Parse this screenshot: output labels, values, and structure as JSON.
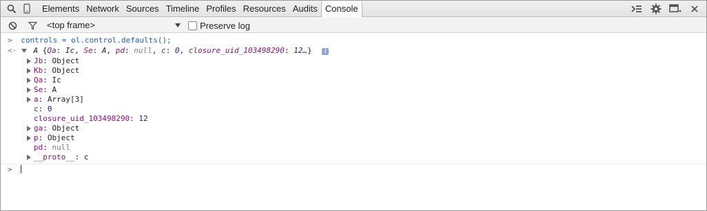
{
  "toolbar": {
    "tabs": [
      "Elements",
      "Network",
      "Sources",
      "Timeline",
      "Profiles",
      "Resources",
      "Audits",
      "Console"
    ],
    "active_tab": "Console"
  },
  "subbar": {
    "frame": "<top frame>",
    "preserve_log": "Preserve log"
  },
  "console": {
    "command": "controls = ol.control.defaults();",
    "summary": {
      "class": "A",
      "text": "{Qa: Ic, Se: A, pd: null, c: 0, closure_uid_103498290: 12…}",
      "parts": [
        {
          "k": "Qa",
          "v": "Ic",
          "t": "val"
        },
        {
          "k": "Se",
          "v": "A",
          "t": "val"
        },
        {
          "k": "pd",
          "v": "null",
          "t": "dim"
        },
        {
          "k": "c",
          "v": "0",
          "t": "num"
        },
        {
          "k": "closure_uid_103498290",
          "v": "12…",
          "t": "num"
        }
      ]
    },
    "info_badge": "i",
    "properties": [
      {
        "key": "Jb",
        "value": "Object",
        "expandable": true,
        "type": "val"
      },
      {
        "key": "Kb",
        "value": "Object",
        "expandable": true,
        "type": "val"
      },
      {
        "key": "Qa",
        "value": "Ic",
        "expandable": true,
        "type": "val"
      },
      {
        "key": "Se",
        "value": "A",
        "expandable": true,
        "type": "val"
      },
      {
        "key": "a",
        "value": "Array[3]",
        "expandable": true,
        "type": "val"
      },
      {
        "key": "c",
        "value": "0",
        "expandable": false,
        "type": "num"
      },
      {
        "key": "closure_uid_103498290",
        "value": "12",
        "expandable": false,
        "type": "num"
      },
      {
        "key": "ga",
        "value": "Object",
        "expandable": true,
        "type": "val"
      },
      {
        "key": "p",
        "value": "Object",
        "expandable": true,
        "type": "val"
      },
      {
        "key": "pd",
        "value": "null",
        "expandable": false,
        "type": "dim"
      },
      {
        "key": "__proto__",
        "value": "c",
        "expandable": true,
        "type": "val"
      }
    ]
  },
  "colors": {
    "prompt": "#2d6fd1",
    "key": "#881280",
    "number": "#1a1aa6"
  },
  "icons": [
    "search-icon",
    "device-icon",
    "block-icon",
    "filter-icon",
    "drawer-toggle-icon",
    "gear-icon",
    "dock-icon",
    "close-icon"
  ]
}
